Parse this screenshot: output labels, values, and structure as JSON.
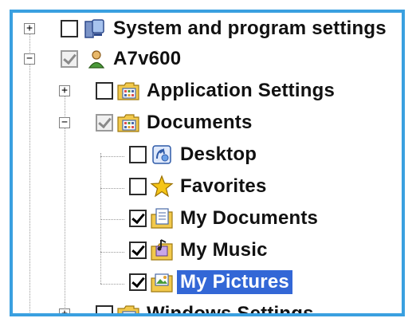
{
  "tree": {
    "items": [
      {
        "label": "System and program settings",
        "expander": "+",
        "checkbox": "unchecked",
        "icon": "computer-settings-icon"
      },
      {
        "label": "A7v600",
        "expander": "−",
        "checkbox": "grayed",
        "icon": "user-icon"
      },
      {
        "label": "Application Settings",
        "expander": "+",
        "checkbox": "unchecked",
        "icon": "folder-settings-icon"
      },
      {
        "label": "Documents",
        "expander": "−",
        "checkbox": "grayed",
        "icon": "folder-settings-icon"
      },
      {
        "label": "Desktop",
        "checkbox": "unchecked",
        "icon": "desktop-icon"
      },
      {
        "label": "Favorites",
        "checkbox": "unchecked",
        "icon": "star-icon"
      },
      {
        "label": "My Documents",
        "checkbox": "checked",
        "icon": "document-folder-icon"
      },
      {
        "label": "My Music",
        "checkbox": "checked",
        "icon": "music-folder-icon"
      },
      {
        "label": "My Pictures",
        "checkbox": "checked",
        "icon": "pictures-folder-icon",
        "selected": true
      },
      {
        "label": "Windows Settings",
        "expander": "+",
        "checkbox": "unchecked",
        "icon": "folder-settings-icon"
      }
    ]
  },
  "colors": {
    "border": "#3aa0e0",
    "selection": "#3367d6"
  }
}
